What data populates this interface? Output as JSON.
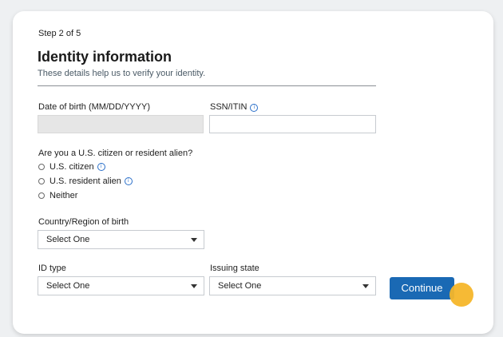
{
  "header": {
    "step": "Step 2 of 5",
    "title": "Identity information",
    "subtitle": "These details help us to verify your identity."
  },
  "fields": {
    "dob_label": "Date of birth (MM/DD/YYYY)",
    "dob_value": "",
    "ssn_label": "SSN/ITIN",
    "ssn_value": ""
  },
  "citizenship": {
    "question": "Are you a U.S. citizen or resident alien?",
    "options": [
      {
        "label": "U.S. citizen",
        "has_info": true,
        "selected": false
      },
      {
        "label": "U.S. resident alien",
        "has_info": true,
        "selected": false
      },
      {
        "label": "Neither",
        "has_info": false,
        "selected": false
      }
    ]
  },
  "country": {
    "label": "Country/Region of birth",
    "value": "Select One"
  },
  "id_type": {
    "label": "ID type",
    "value": "Select One"
  },
  "issuing_state": {
    "label": "Issuing state",
    "value": "Select One"
  },
  "actions": {
    "continue_label": "Continue"
  },
  "icons": {
    "info": "info-circle-icon",
    "dropdown": "caret-down-icon"
  },
  "colors": {
    "accent": "#1a69b4",
    "info_icon": "#2a6fc9",
    "cursor_highlight": "#f5b62a"
  }
}
